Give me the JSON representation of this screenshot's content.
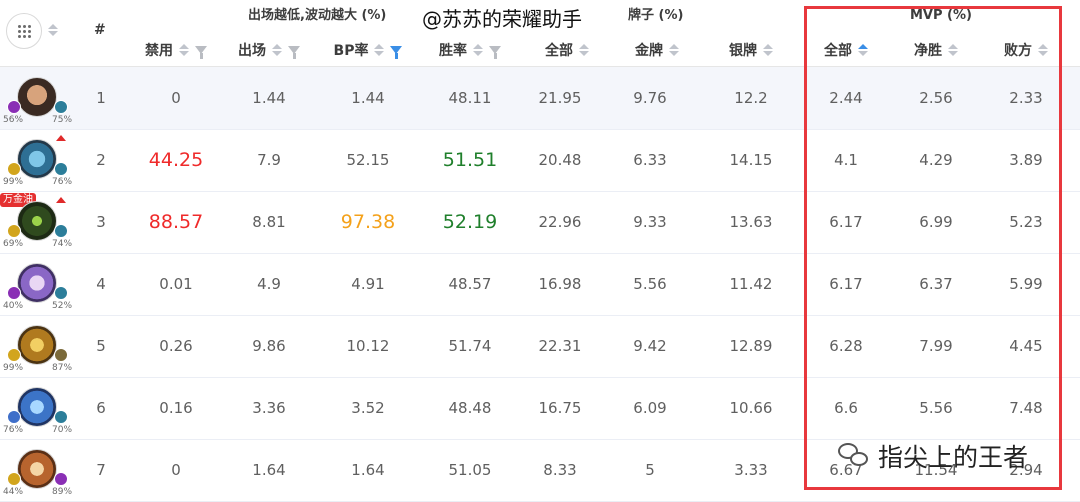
{
  "watermark_text": "@苏苏的荣耀助手",
  "groups": {
    "bp_note": "出场越低,波动越大 (%)",
    "pai_zi": "牌子 (%)",
    "mvp": "MVP (%)"
  },
  "rank_header": "#",
  "columns": {
    "ban": "禁用",
    "appear": "出场",
    "bp": "BP率",
    "win": "胜率",
    "all": "全部",
    "gold": "金牌",
    "silver": "银牌",
    "mvp_all": "全部",
    "mvp_win": "净胜",
    "mvp_lose": "败方"
  },
  "rows": [
    {
      "rank": "1",
      "left_pct": "56%",
      "right_pct": "75%",
      "tag": "",
      "up": false,
      "ban": "0",
      "appear": "1.44",
      "bp": "1.44",
      "win": "48.11",
      "all": "21.95",
      "gold": "9.76",
      "silver": "12.2",
      "mvp_all": "2.44",
      "mvp_win": "2.56",
      "mvp_lose": "2.33"
    },
    {
      "rank": "2",
      "left_pct": "99%",
      "right_pct": "76%",
      "tag": "",
      "up": true,
      "ban": "44.25",
      "appear": "7.9",
      "bp": "52.15",
      "win": "51.51",
      "all": "20.48",
      "gold": "6.33",
      "silver": "14.15",
      "mvp_all": "4.1",
      "mvp_win": "4.29",
      "mvp_lose": "3.89"
    },
    {
      "rank": "3",
      "left_pct": "69%",
      "right_pct": "74%",
      "tag": "万金油",
      "up": true,
      "ban": "88.57",
      "appear": "8.81",
      "bp": "97.38",
      "win": "52.19",
      "all": "22.96",
      "gold": "9.33",
      "silver": "13.63",
      "mvp_all": "6.17",
      "mvp_win": "6.99",
      "mvp_lose": "5.23"
    },
    {
      "rank": "4",
      "left_pct": "40%",
      "right_pct": "52%",
      "tag": "",
      "up": false,
      "ban": "0.01",
      "appear": "4.9",
      "bp": "4.91",
      "win": "48.57",
      "all": "16.98",
      "gold": "5.56",
      "silver": "11.42",
      "mvp_all": "6.17",
      "mvp_win": "6.37",
      "mvp_lose": "5.99"
    },
    {
      "rank": "5",
      "left_pct": "99%",
      "right_pct": "87%",
      "tag": "",
      "up": false,
      "ban": "0.26",
      "appear": "9.86",
      "bp": "10.12",
      "win": "51.74",
      "all": "22.31",
      "gold": "9.42",
      "silver": "12.89",
      "mvp_all": "6.28",
      "mvp_win": "7.99",
      "mvp_lose": "4.45"
    },
    {
      "rank": "6",
      "left_pct": "76%",
      "right_pct": "70%",
      "tag": "",
      "up": false,
      "ban": "0.16",
      "appear": "3.36",
      "bp": "3.52",
      "win": "48.48",
      "all": "16.75",
      "gold": "6.09",
      "silver": "10.66",
      "mvp_all": "6.6",
      "mvp_win": "5.56",
      "mvp_lose": "7.48"
    },
    {
      "rank": "7",
      "left_pct": "44%",
      "right_pct": "89%",
      "tag": "",
      "up": false,
      "ban": "0",
      "appear": "1.64",
      "bp": "1.64",
      "win": "51.05",
      "all": "8.33",
      "gold": "5",
      "silver": "3.33",
      "mvp_all": "6.67",
      "mvp_win": "11.54",
      "mvp_lose": "2.94"
    }
  ],
  "brand_footer": "指尖上的王者",
  "colors": {
    "accent_blue": "#3a8ee6",
    "highlight_red": "#e8383d",
    "value_red": "#ef2a2a",
    "value_green": "#1f7f2b",
    "value_orange": "#f4a11a"
  }
}
